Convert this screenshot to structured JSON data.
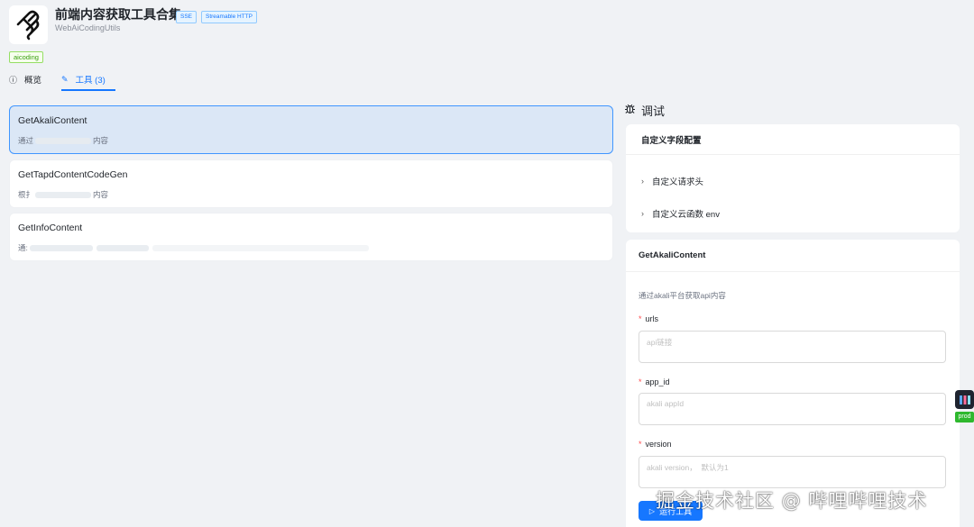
{
  "header": {
    "title": "前端内容获取工具合集",
    "badges": [
      "SSE",
      "Streamable HTTP"
    ],
    "subtitle": "WebAiCodingUtils",
    "tag": "aicoding"
  },
  "tabs": [
    {
      "label": "概览",
      "icon": "info-circle-icon"
    },
    {
      "label": "工具 (3)",
      "icon": "tool-icon"
    }
  ],
  "tools": [
    {
      "name": "GetAkaliContent",
      "desc_prefix": "通过",
      "desc_suffix": "内容"
    },
    {
      "name": "GetTapdContentCodeGen",
      "desc_prefix": "根扌",
      "desc_suffix": "内容"
    },
    {
      "name": "GetInfoContent",
      "desc_prefix": "通:",
      "desc_suffix": ""
    }
  ],
  "debug": {
    "title": "调试",
    "custom_config": {
      "title": "自定义字段配置",
      "items": [
        "自定义请求头",
        "自定义云函数 env"
      ]
    },
    "form": {
      "title": "GetAkaliContent",
      "description": "通过akali平台获取api内容",
      "fields": [
        {
          "label": "urls",
          "placeholder": "api链接",
          "required": true
        },
        {
          "label": "app_id",
          "placeholder": "akali appId",
          "required": true
        },
        {
          "label": "version",
          "placeholder": "akali version，  默认为1",
          "required": true
        }
      ],
      "run_label": "运行工具"
    }
  },
  "env_badge": "prod",
  "watermark": "掘金技术社区 @ 哔哩哔哩技术",
  "colors": {
    "primary": "#1677ff",
    "tag_green": "#389e0d",
    "required": "#ff4d4f"
  }
}
